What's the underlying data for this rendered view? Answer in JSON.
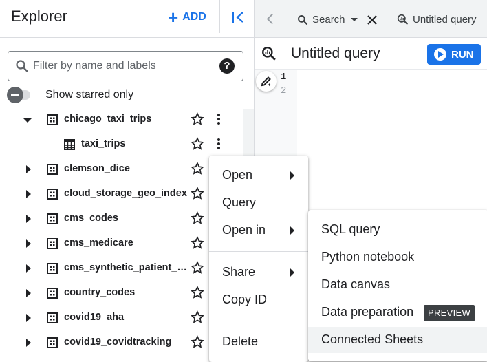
{
  "explorer": {
    "title": "Explorer",
    "add_label": "ADD",
    "filter_placeholder": "Filter by name and labels",
    "starred_toggle_label": "Show starred only",
    "tree": [
      {
        "name": "chicago_taxi_trips",
        "type": "dataset",
        "expanded": true
      },
      {
        "name": "taxi_trips",
        "type": "table"
      },
      {
        "name": "clemson_dice",
        "type": "dataset"
      },
      {
        "name": "cloud_storage_geo_index",
        "type": "dataset"
      },
      {
        "name": "cms_codes",
        "type": "dataset"
      },
      {
        "name": "cms_medicare",
        "type": "dataset"
      },
      {
        "name": "cms_synthetic_patient_d...",
        "type": "dataset"
      },
      {
        "name": "country_codes",
        "type": "dataset"
      },
      {
        "name": "covid19_aha",
        "type": "dataset"
      },
      {
        "name": "covid19_covidtracking",
        "type": "dataset"
      }
    ]
  },
  "tabs": {
    "search_label": "Search",
    "untitled_label": "Untitled query"
  },
  "query": {
    "title": "Untitled query",
    "run_label": "RUN",
    "line_numbers": [
      "1",
      "2"
    ]
  },
  "context_menu": {
    "items": [
      {
        "label": "Open",
        "submenu": true
      },
      {
        "label": "Query",
        "submenu": false
      },
      {
        "label": "Open in",
        "submenu": true
      },
      {
        "label": "Share",
        "submenu": true
      },
      {
        "label": "Copy ID",
        "submenu": false
      },
      {
        "label": "Delete",
        "submenu": false
      }
    ]
  },
  "open_in_menu": {
    "items": [
      {
        "label": "SQL query"
      },
      {
        "label": "Python notebook"
      },
      {
        "label": "Data canvas"
      },
      {
        "label": "Data preparation",
        "badge": "PREVIEW"
      },
      {
        "label": "Connected Sheets"
      }
    ]
  },
  "colors": {
    "accent": "#1a73e8",
    "text": "#202124",
    "badge_bg": "#3c4043"
  }
}
